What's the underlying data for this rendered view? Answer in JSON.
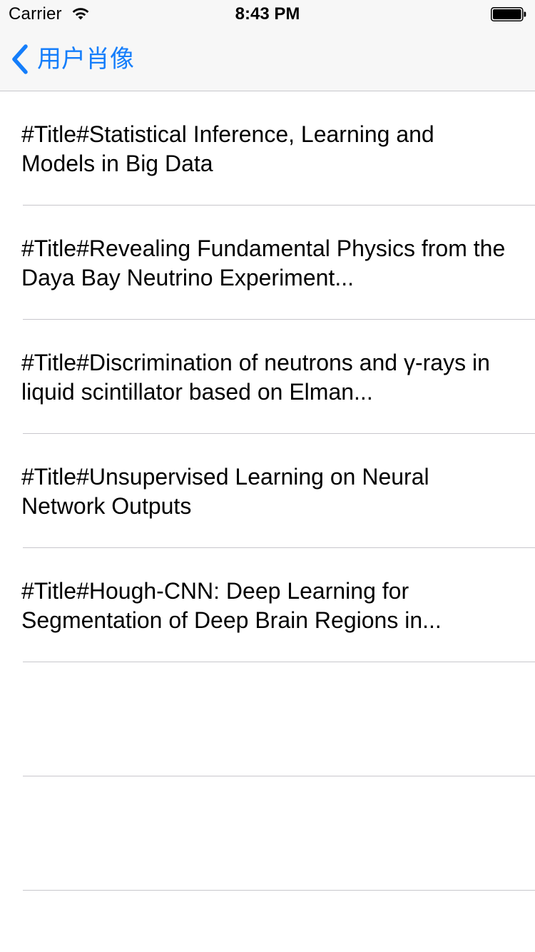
{
  "status_bar": {
    "carrier": "Carrier",
    "time": "8:43 PM"
  },
  "nav": {
    "back_label": "用户肖像",
    "accent_color": "#157efb"
  },
  "table": {
    "rows": [
      {
        "text": "#Title#Statistical Inference, Learning and Models in Big Data"
      },
      {
        "text": "#Title#Revealing Fundamental Physics from the Daya Bay Neutrino Experiment..."
      },
      {
        "text": "#Title#Discrimination of neutrons and γ-rays in liquid scintillator  based on Elman..."
      },
      {
        "text": "#Title#Unsupervised Learning on Neural Network Outputs"
      },
      {
        "text": "#Title#Hough-CNN: Deep Learning for Segmentation of Deep Brain Regions in..."
      },
      {
        "text": ""
      },
      {
        "text": ""
      }
    ]
  },
  "icons": {
    "wifi": "wifi-icon",
    "battery": "battery-icon",
    "back": "chevron-left-icon"
  }
}
